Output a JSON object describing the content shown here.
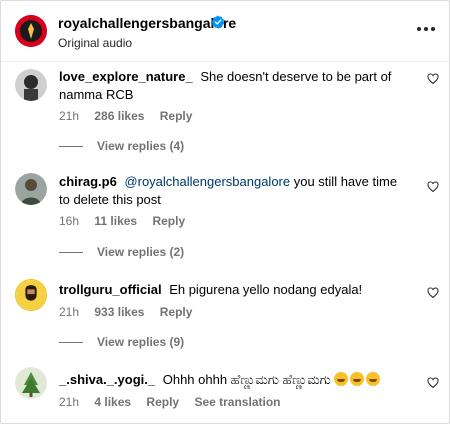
{
  "header": {
    "username": "royalchallengersbangalore",
    "audio_label": "Original audio",
    "verified_icon": "verified-badge-icon",
    "more_icon": "more-options-icon",
    "brand_color": "#d6001c"
  },
  "comments": [
    {
      "username": "love_explore_nature_",
      "text": "She doesn't deserve to be part of namma RCB",
      "age": "21h",
      "likes": "286 likes",
      "reply_label": "Reply",
      "view_replies": "View replies (4)"
    },
    {
      "username": "chirag.p6",
      "mention": "@royalchallengersbangalore",
      "text": "you still have time to delete this post",
      "age": "16h",
      "likes": "11 likes",
      "reply_label": "Reply",
      "view_replies": "View replies (2)"
    },
    {
      "username": "trollguru_official",
      "text": "Eh pigurena yello nodang edyala!",
      "age": "21h",
      "likes": "933 likes",
      "reply_label": "Reply",
      "view_replies": "View replies (9)"
    },
    {
      "username": "_.shiva._.yogi._",
      "text": "Ohhh ohhh ಹೆಣ್ಣುಮಗು ಹೆಣ್ಣುಮಗು",
      "emoji_count": 3,
      "age": "21h",
      "likes": "4 likes",
      "reply_label": "Reply",
      "see_translation": "See translation"
    }
  ],
  "icons": {
    "like": "heart-outline-icon",
    "emoji": "laughing-emoji-icon"
  }
}
